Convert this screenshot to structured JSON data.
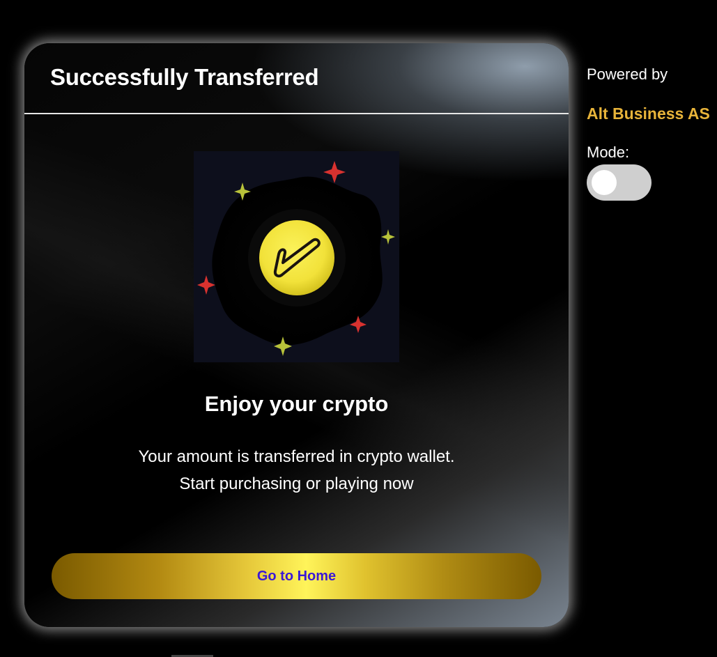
{
  "card": {
    "title": "Successfully Transferred",
    "heading": "Enjoy your crypto",
    "description_line1": "Your amount is transferred in crypto wallet.",
    "description_line2": "Start purchasing or playing now",
    "button_label": "Go to Home"
  },
  "sidebar": {
    "powered_label": "Powered by",
    "company": "Alt Business AS",
    "mode_label": "Mode:",
    "mode_toggle_on": false
  },
  "illustration": {
    "icon": "check-coin-icon",
    "sparkle_icons": [
      "star-icon"
    ]
  },
  "colors": {
    "accent_gold": "#e8b43a",
    "button_text": "#3a18d6",
    "coin_yellow": "#f2e23a",
    "sparkle_red": "#d8322f",
    "sparkle_green": "#b8c23a"
  }
}
